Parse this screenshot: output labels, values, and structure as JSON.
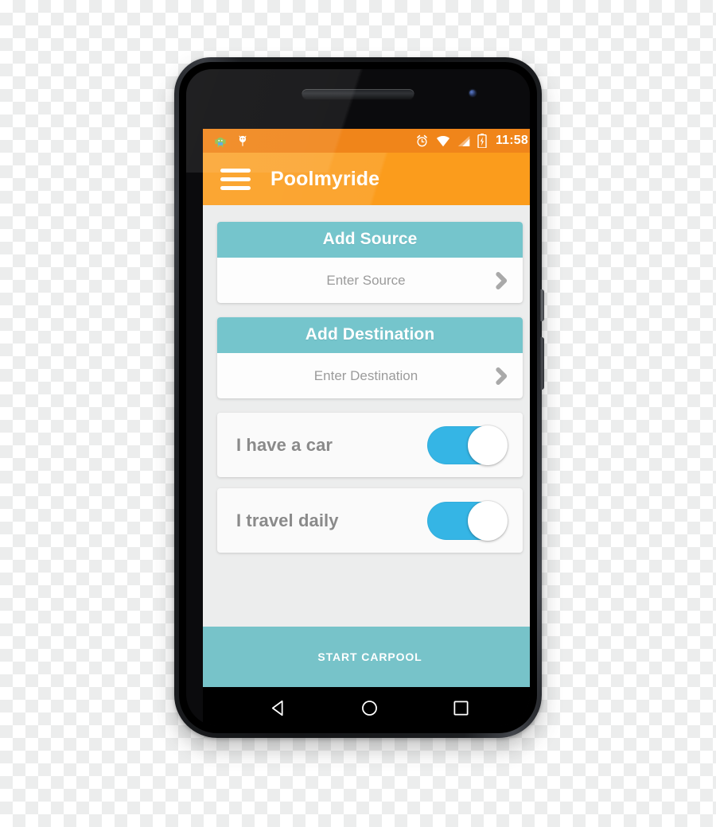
{
  "device": {
    "type": "android-phone-mockup",
    "parts": {
      "earpiece": "earpiece-speaker",
      "front_camera": "front-camera",
      "bottom_speaker": "bottom-speaker",
      "power_button": "power-button",
      "volume_button": "volume-button"
    }
  },
  "status_bar": {
    "background": "#f0851a",
    "left_icons": [
      {
        "name": "android-bugdroid-icon",
        "glyph": "bugdroid"
      },
      {
        "name": "android-debug-icon",
        "glyph": "debug-android"
      }
    ],
    "right_icons": [
      {
        "name": "alarm-clock-icon"
      },
      {
        "name": "wifi-icon"
      },
      {
        "name": "cellular-signal-icon"
      },
      {
        "name": "battery-charging-icon"
      }
    ],
    "clock": "11:58"
  },
  "app_bar": {
    "background": "#fb9c1c",
    "menu_icon": "hamburger-menu-icon",
    "title": "Poolmyride"
  },
  "theme": {
    "accent_teal": "#75c5cc",
    "accent_orange": "#fb9c1c",
    "status_orange": "#f0851a",
    "toggle_blue": "#35b5e5",
    "screen_background": "#eceded",
    "card_background": "#fafafa",
    "placeholder_text": "#9b9b9b",
    "label_text": "#8a8a8a"
  },
  "content": {
    "fields": [
      {
        "header": "Add Source",
        "placeholder": "Enter Source",
        "value": "",
        "chevron": "chevron-right-icon"
      },
      {
        "header": "Add Destination",
        "placeholder": "Enter Destination",
        "value": "",
        "chevron": "chevron-right-icon"
      }
    ],
    "toggles": [
      {
        "label": "I have a car",
        "state": "on"
      },
      {
        "label": "I travel daily",
        "state": "on"
      }
    ]
  },
  "footer": {
    "start_button_label": "START CARPOOL"
  },
  "nav_bar": {
    "buttons": [
      {
        "name": "back-button",
        "glyph": "triangle-left"
      },
      {
        "name": "home-button",
        "glyph": "circle"
      },
      {
        "name": "recents-button",
        "glyph": "square"
      }
    ]
  }
}
